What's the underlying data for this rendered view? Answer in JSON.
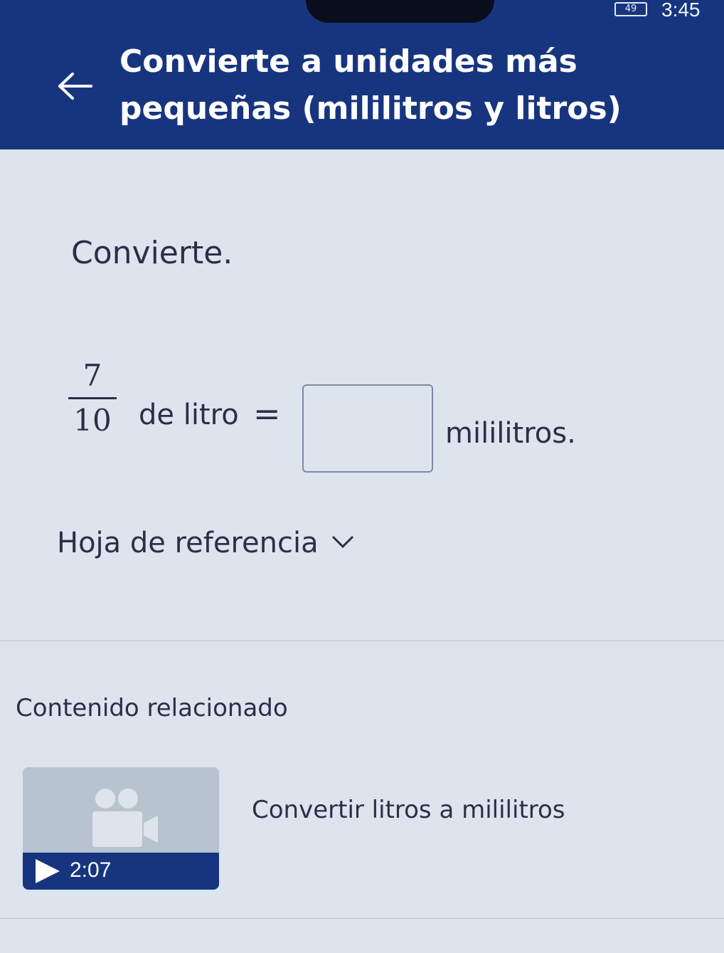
{
  "status_bar": {
    "battery": "49",
    "time": "3:45"
  },
  "header": {
    "title": "Convierte a unidades más pequeñas (mililitros y litros)",
    "back_icon": "arrow-left-icon"
  },
  "exercise": {
    "instruction": "Convierte.",
    "numerator": "7",
    "denominator": "10",
    "from_unit": "de litro",
    "equals": "=",
    "answer_value": "",
    "to_unit": "mililitros."
  },
  "reference": {
    "label": "Hoja de referencia",
    "icon": "chevron-down-icon"
  },
  "related": {
    "title": "Contenido relacionado",
    "video": {
      "duration": "2:07",
      "title": "Convertir litros a mililitros",
      "icon": "video-camera-icon"
    }
  },
  "colors": {
    "header_bg": "#17357f",
    "page_bg": "#dce5ee",
    "text": "#2a2f48"
  }
}
